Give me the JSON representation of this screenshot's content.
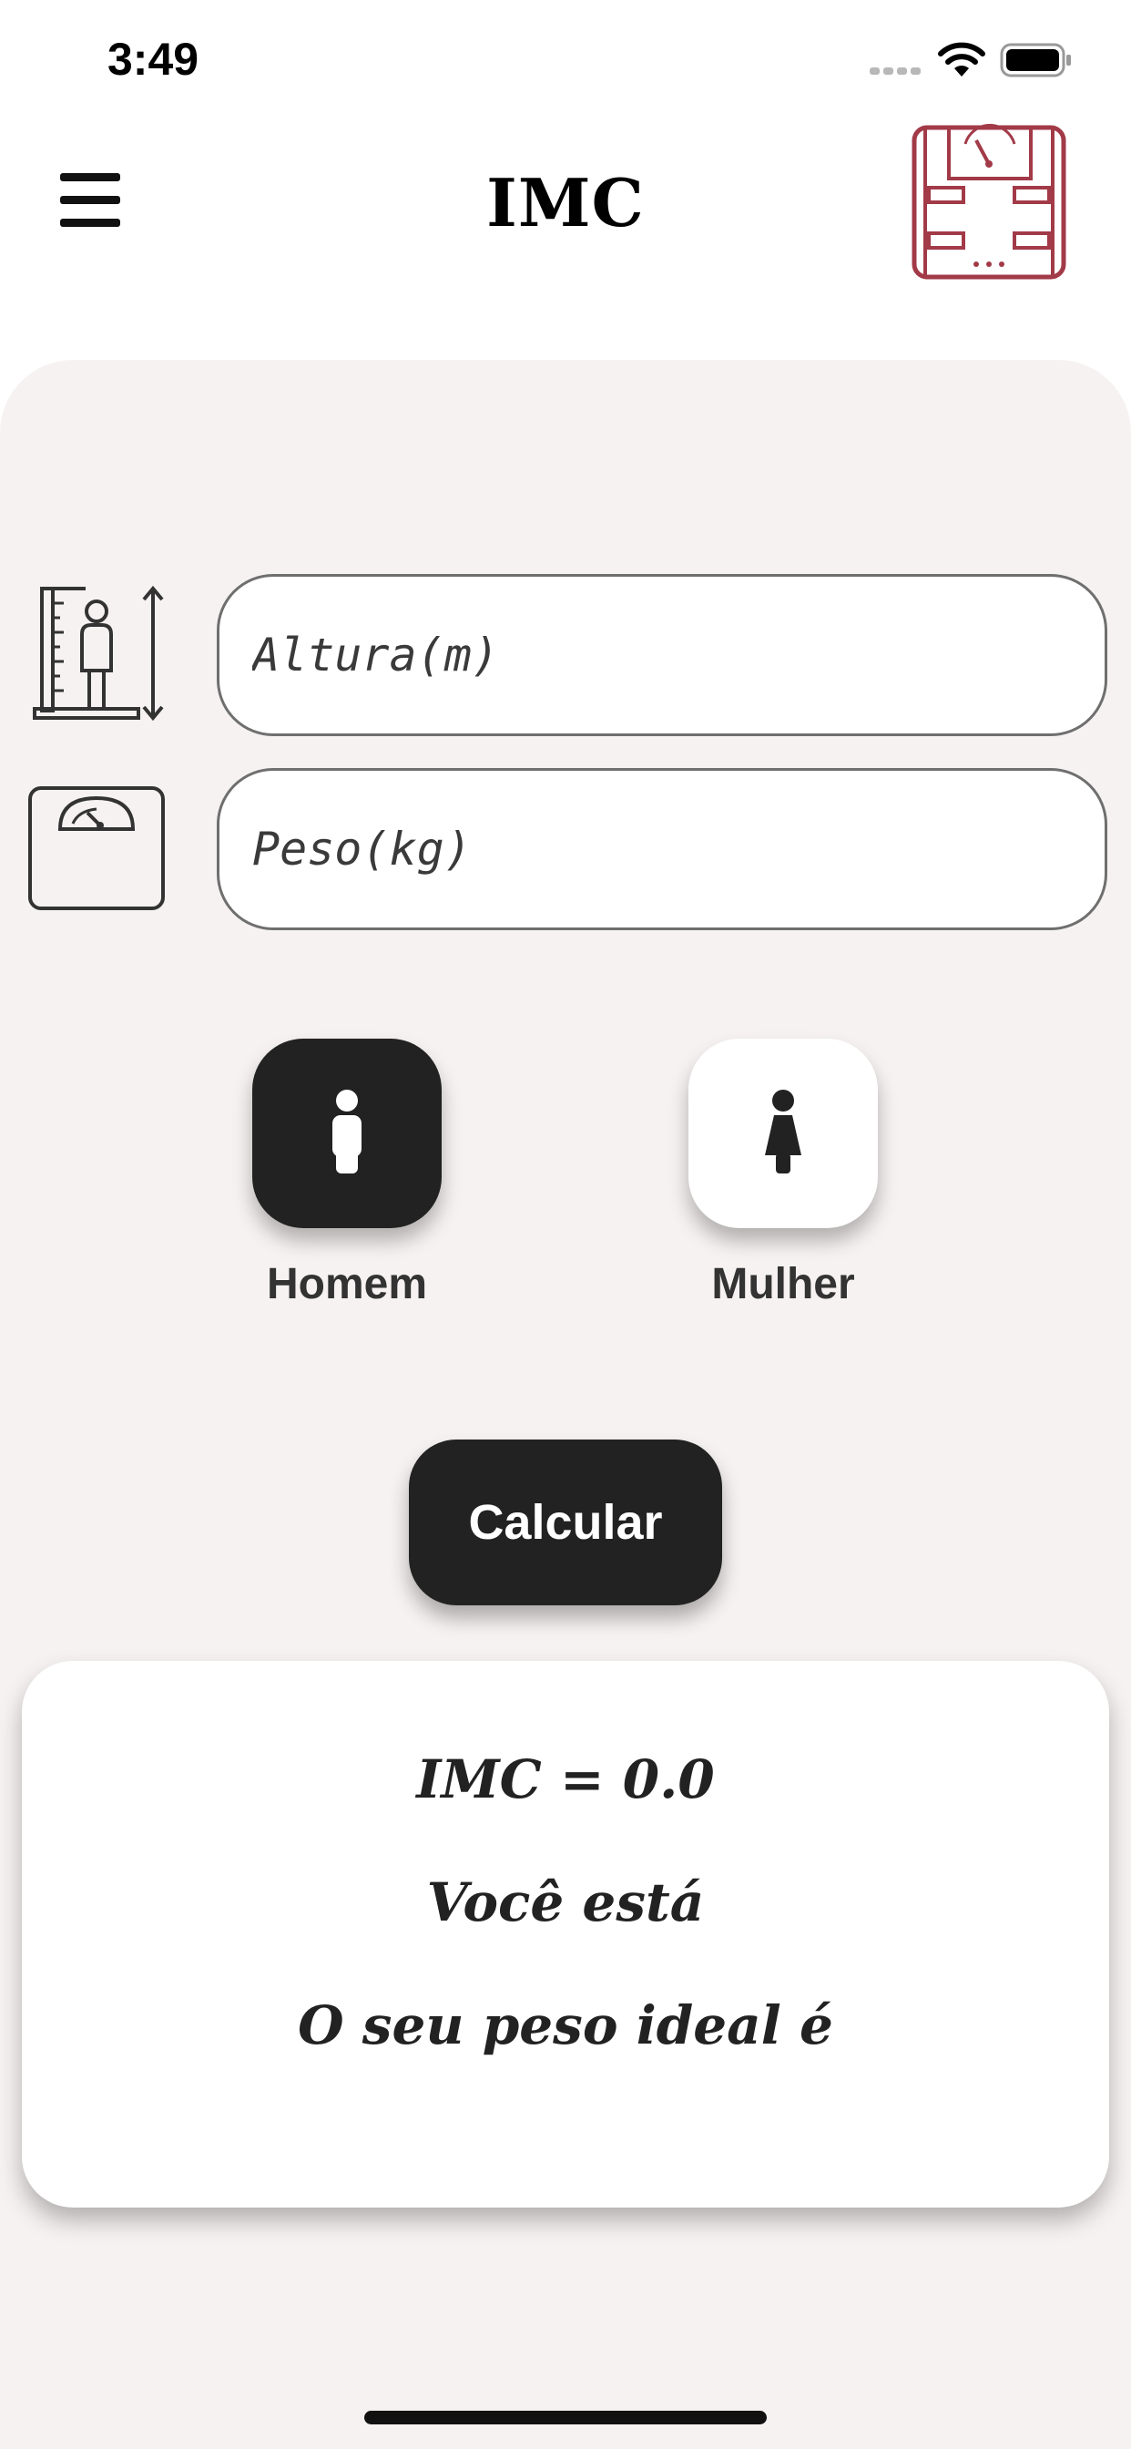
{
  "status_bar": {
    "time": "3:49"
  },
  "header": {
    "title": "IMC"
  },
  "form": {
    "height_placeholder": "Altura(m)",
    "height_value": "",
    "weight_placeholder": "Peso(kg)",
    "weight_value": ""
  },
  "gender": {
    "selected": "Homem",
    "options": [
      {
        "label": "Homem",
        "icon": "male-icon"
      },
      {
        "label": "Mulher",
        "icon": "female-icon"
      }
    ]
  },
  "calculate_label": "Calcular",
  "result": {
    "imc_line": "IMC = 0.0",
    "status_line": "Você está",
    "ideal_line": "O seu peso ideal é"
  },
  "colors": {
    "accent": "#a23a48",
    "dark": "#222222",
    "background": "#f7f2f2"
  }
}
